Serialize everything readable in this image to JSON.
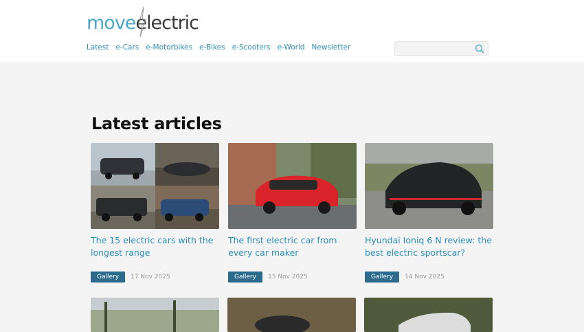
{
  "logo": {
    "part1": "move",
    "part2": "electric"
  },
  "nav": [
    "Latest",
    "e-Cars",
    "e-Motorbikes",
    "e-Bikes",
    "e-Scooters",
    "e-World",
    "Newsletter"
  ],
  "search": {
    "placeholder": ""
  },
  "section": {
    "title": "Latest articles"
  },
  "articles": [
    {
      "title": "The 15 electric cars with the longest range",
      "badge": "Gallery",
      "date": "17 Nov 2025"
    },
    {
      "title": "The first electric car from every car maker",
      "badge": "Gallery",
      "date": "15 Nov 2025"
    },
    {
      "title": "Hyundai Ioniq 6 N review: the best electric sportscar?",
      "badge": "Gallery",
      "date": "14 Nov 2025"
    }
  ],
  "colors": {
    "accent": "#2b8fba",
    "badge": "#2d6b8d",
    "logo_blue": "#4ca9c9"
  },
  "icons": {
    "search": "search-icon"
  }
}
